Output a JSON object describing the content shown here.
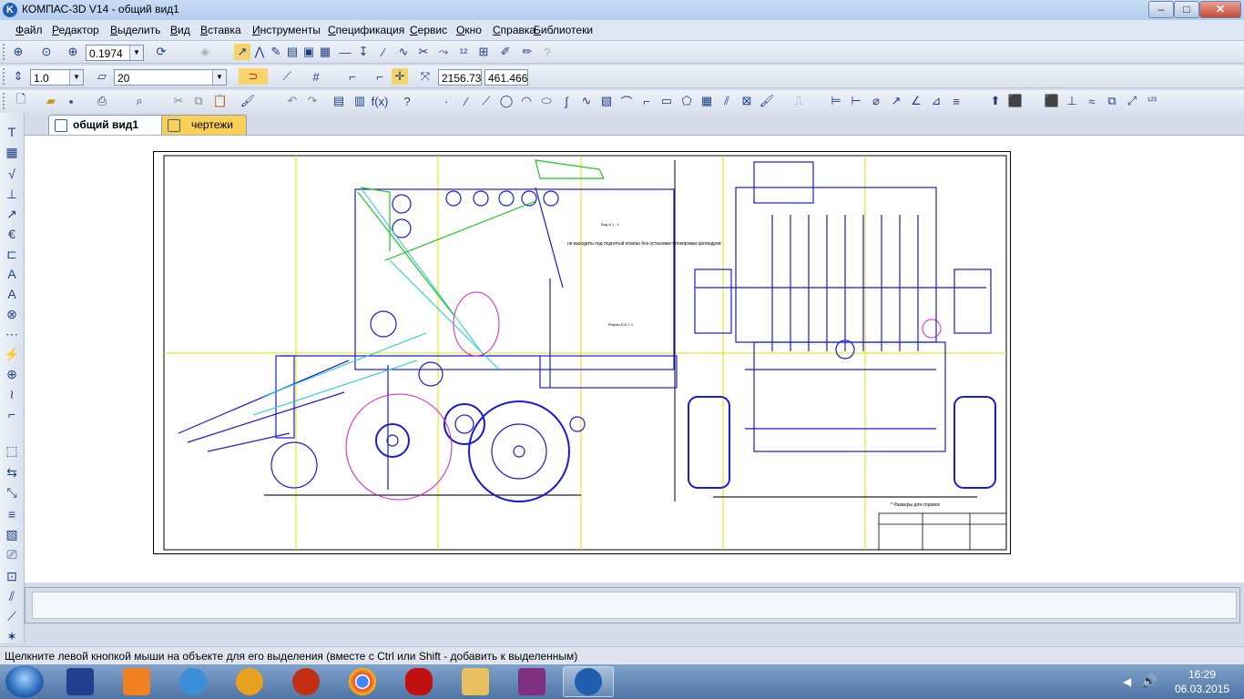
{
  "window": {
    "title": "КОМПАС-3D V14 - общий вид1",
    "app_icon": "K"
  },
  "window_controls": {
    "minimize": "–",
    "maximize": "□",
    "close": "✕"
  },
  "menu": [
    "Файл",
    "Редактор",
    "Выделить",
    "Вид",
    "Вставка",
    "Инструменты",
    "Спецификация",
    "Сервис",
    "Окно",
    "Справка",
    "Библиотеки"
  ],
  "toolbar": {
    "zoom_value": "0.1974",
    "step_value": "1.0",
    "layer_value": "20",
    "coord_x": "2156.73",
    "coord_y": "461.466"
  },
  "tabs": [
    {
      "label": "общий вид1",
      "active": true,
      "close": "✕"
    },
    {
      "label": "чертежи",
      "active": false
    }
  ],
  "drawing": {
    "view_label_1": "Вид А  1 : 1",
    "view_label_2": "Разрез Б-Б  1:1",
    "note": "не выходить под поднятый клапан без остановки блокировки цилиндров",
    "stamp_note": "* Размеры для справок"
  },
  "status": {
    "hint": "Щелкните левой кнопкой мыши на объекте для его выделения (вместе с Ctrl или Shift - добавить к выделенным)"
  },
  "taskbar": {
    "apps": [
      "save-app",
      "media-player",
      "remote-app",
      "autocad",
      "maple-app",
      "chrome",
      "opera",
      "explorer",
      "winrar",
      "kompas"
    ],
    "clock_time": "16:29",
    "clock_date": "06.03.2015"
  }
}
